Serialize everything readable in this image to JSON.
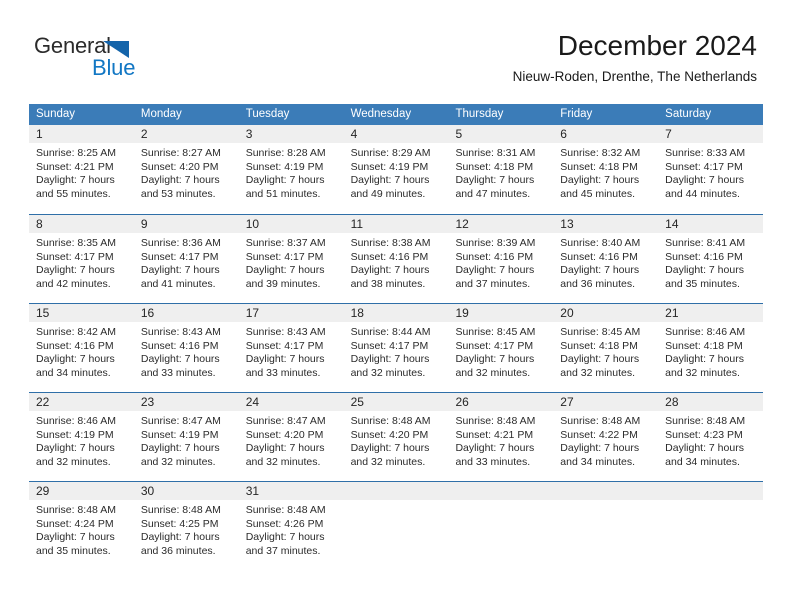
{
  "logo": {
    "text_top": "General",
    "text_bottom": "Blue",
    "triangle_color": "#1464aa",
    "blue_color": "#1277c4"
  },
  "header": {
    "title": "December 2024",
    "subtitle": "Nieuw-Roden, Drenthe, The Netherlands"
  },
  "theme": {
    "header_bg": "#3b7cb8",
    "row_border": "#2f6fa8",
    "day_band_bg": "#efefef"
  },
  "weekdays": [
    "Sunday",
    "Monday",
    "Tuesday",
    "Wednesday",
    "Thursday",
    "Friday",
    "Saturday"
  ],
  "weeks": [
    [
      {
        "day": "1",
        "sunrise": "Sunrise: 8:25 AM",
        "sunset": "Sunset: 4:21 PM",
        "daylight1": "Daylight: 7 hours",
        "daylight2": "and 55 minutes."
      },
      {
        "day": "2",
        "sunrise": "Sunrise: 8:27 AM",
        "sunset": "Sunset: 4:20 PM",
        "daylight1": "Daylight: 7 hours",
        "daylight2": "and 53 minutes."
      },
      {
        "day": "3",
        "sunrise": "Sunrise: 8:28 AM",
        "sunset": "Sunset: 4:19 PM",
        "daylight1": "Daylight: 7 hours",
        "daylight2": "and 51 minutes."
      },
      {
        "day": "4",
        "sunrise": "Sunrise: 8:29 AM",
        "sunset": "Sunset: 4:19 PM",
        "daylight1": "Daylight: 7 hours",
        "daylight2": "and 49 minutes."
      },
      {
        "day": "5",
        "sunrise": "Sunrise: 8:31 AM",
        "sunset": "Sunset: 4:18 PM",
        "daylight1": "Daylight: 7 hours",
        "daylight2": "and 47 minutes."
      },
      {
        "day": "6",
        "sunrise": "Sunrise: 8:32 AM",
        "sunset": "Sunset: 4:18 PM",
        "daylight1": "Daylight: 7 hours",
        "daylight2": "and 45 minutes."
      },
      {
        "day": "7",
        "sunrise": "Sunrise: 8:33 AM",
        "sunset": "Sunset: 4:17 PM",
        "daylight1": "Daylight: 7 hours",
        "daylight2": "and 44 minutes."
      }
    ],
    [
      {
        "day": "8",
        "sunrise": "Sunrise: 8:35 AM",
        "sunset": "Sunset: 4:17 PM",
        "daylight1": "Daylight: 7 hours",
        "daylight2": "and 42 minutes."
      },
      {
        "day": "9",
        "sunrise": "Sunrise: 8:36 AM",
        "sunset": "Sunset: 4:17 PM",
        "daylight1": "Daylight: 7 hours",
        "daylight2": "and 41 minutes."
      },
      {
        "day": "10",
        "sunrise": "Sunrise: 8:37 AM",
        "sunset": "Sunset: 4:17 PM",
        "daylight1": "Daylight: 7 hours",
        "daylight2": "and 39 minutes."
      },
      {
        "day": "11",
        "sunrise": "Sunrise: 8:38 AM",
        "sunset": "Sunset: 4:16 PM",
        "daylight1": "Daylight: 7 hours",
        "daylight2": "and 38 minutes."
      },
      {
        "day": "12",
        "sunrise": "Sunrise: 8:39 AM",
        "sunset": "Sunset: 4:16 PM",
        "daylight1": "Daylight: 7 hours",
        "daylight2": "and 37 minutes."
      },
      {
        "day": "13",
        "sunrise": "Sunrise: 8:40 AM",
        "sunset": "Sunset: 4:16 PM",
        "daylight1": "Daylight: 7 hours",
        "daylight2": "and 36 minutes."
      },
      {
        "day": "14",
        "sunrise": "Sunrise: 8:41 AM",
        "sunset": "Sunset: 4:16 PM",
        "daylight1": "Daylight: 7 hours",
        "daylight2": "and 35 minutes."
      }
    ],
    [
      {
        "day": "15",
        "sunrise": "Sunrise: 8:42 AM",
        "sunset": "Sunset: 4:16 PM",
        "daylight1": "Daylight: 7 hours",
        "daylight2": "and 34 minutes."
      },
      {
        "day": "16",
        "sunrise": "Sunrise: 8:43 AM",
        "sunset": "Sunset: 4:16 PM",
        "daylight1": "Daylight: 7 hours",
        "daylight2": "and 33 minutes."
      },
      {
        "day": "17",
        "sunrise": "Sunrise: 8:43 AM",
        "sunset": "Sunset: 4:17 PM",
        "daylight1": "Daylight: 7 hours",
        "daylight2": "and 33 minutes."
      },
      {
        "day": "18",
        "sunrise": "Sunrise: 8:44 AM",
        "sunset": "Sunset: 4:17 PM",
        "daylight1": "Daylight: 7 hours",
        "daylight2": "and 32 minutes."
      },
      {
        "day": "19",
        "sunrise": "Sunrise: 8:45 AM",
        "sunset": "Sunset: 4:17 PM",
        "daylight1": "Daylight: 7 hours",
        "daylight2": "and 32 minutes."
      },
      {
        "day": "20",
        "sunrise": "Sunrise: 8:45 AM",
        "sunset": "Sunset: 4:18 PM",
        "daylight1": "Daylight: 7 hours",
        "daylight2": "and 32 minutes."
      },
      {
        "day": "21",
        "sunrise": "Sunrise: 8:46 AM",
        "sunset": "Sunset: 4:18 PM",
        "daylight1": "Daylight: 7 hours",
        "daylight2": "and 32 minutes."
      }
    ],
    [
      {
        "day": "22",
        "sunrise": "Sunrise: 8:46 AM",
        "sunset": "Sunset: 4:19 PM",
        "daylight1": "Daylight: 7 hours",
        "daylight2": "and 32 minutes."
      },
      {
        "day": "23",
        "sunrise": "Sunrise: 8:47 AM",
        "sunset": "Sunset: 4:19 PM",
        "daylight1": "Daylight: 7 hours",
        "daylight2": "and 32 minutes."
      },
      {
        "day": "24",
        "sunrise": "Sunrise: 8:47 AM",
        "sunset": "Sunset: 4:20 PM",
        "daylight1": "Daylight: 7 hours",
        "daylight2": "and 32 minutes."
      },
      {
        "day": "25",
        "sunrise": "Sunrise: 8:48 AM",
        "sunset": "Sunset: 4:20 PM",
        "daylight1": "Daylight: 7 hours",
        "daylight2": "and 32 minutes."
      },
      {
        "day": "26",
        "sunrise": "Sunrise: 8:48 AM",
        "sunset": "Sunset: 4:21 PM",
        "daylight1": "Daylight: 7 hours",
        "daylight2": "and 33 minutes."
      },
      {
        "day": "27",
        "sunrise": "Sunrise: 8:48 AM",
        "sunset": "Sunset: 4:22 PM",
        "daylight1": "Daylight: 7 hours",
        "daylight2": "and 34 minutes."
      },
      {
        "day": "28",
        "sunrise": "Sunrise: 8:48 AM",
        "sunset": "Sunset: 4:23 PM",
        "daylight1": "Daylight: 7 hours",
        "daylight2": "and 34 minutes."
      }
    ],
    [
      {
        "day": "29",
        "sunrise": "Sunrise: 8:48 AM",
        "sunset": "Sunset: 4:24 PM",
        "daylight1": "Daylight: 7 hours",
        "daylight2": "and 35 minutes."
      },
      {
        "day": "30",
        "sunrise": "Sunrise: 8:48 AM",
        "sunset": "Sunset: 4:25 PM",
        "daylight1": "Daylight: 7 hours",
        "daylight2": "and 36 minutes."
      },
      {
        "day": "31",
        "sunrise": "Sunrise: 8:48 AM",
        "sunset": "Sunset: 4:26 PM",
        "daylight1": "Daylight: 7 hours",
        "daylight2": "and 37 minutes."
      },
      {
        "day": "",
        "sunrise": "",
        "sunset": "",
        "daylight1": "",
        "daylight2": ""
      },
      {
        "day": "",
        "sunrise": "",
        "sunset": "",
        "daylight1": "",
        "daylight2": ""
      },
      {
        "day": "",
        "sunrise": "",
        "sunset": "",
        "daylight1": "",
        "daylight2": ""
      },
      {
        "day": "",
        "sunrise": "",
        "sunset": "",
        "daylight1": "",
        "daylight2": ""
      }
    ]
  ]
}
